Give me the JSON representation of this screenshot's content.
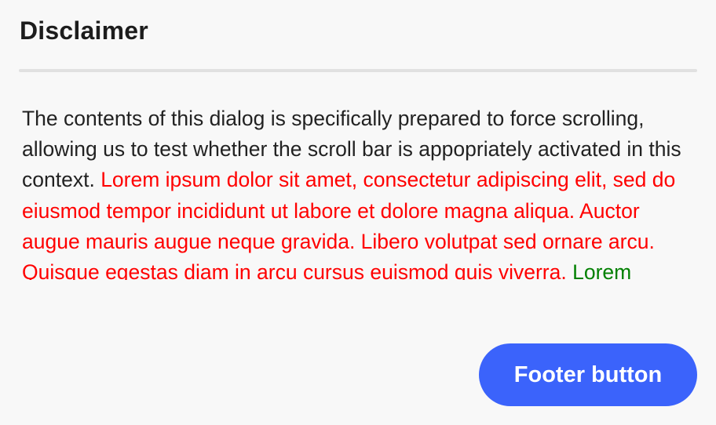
{
  "dialog": {
    "title": "Disclaimer",
    "body": {
      "intro_text": "The contents of this dialog is specifically prepared to force scrolling, allowing us to test whether the scroll bar is appopriately activated in this context.",
      "red_text": "Lorem ipsum dolor sit amet, consectetur adipiscing elit, sed do eiusmod tempor incididunt ut labore et dolore magna aliqua. Auctor augue mauris augue neque gravida. Libero volutpat sed ornare arcu. Quisque egestas diam in arcu cursus euismod quis viverra.",
      "green_text": "Lorem"
    },
    "footer": {
      "button_label": "Footer button"
    }
  },
  "colors": {
    "background": "#f8f8f8",
    "divider": "#e1e1e1",
    "red_text": "#ff0000",
    "green_text": "#008000",
    "button_bg": "#3b63fb",
    "button_text": "#ffffff"
  }
}
